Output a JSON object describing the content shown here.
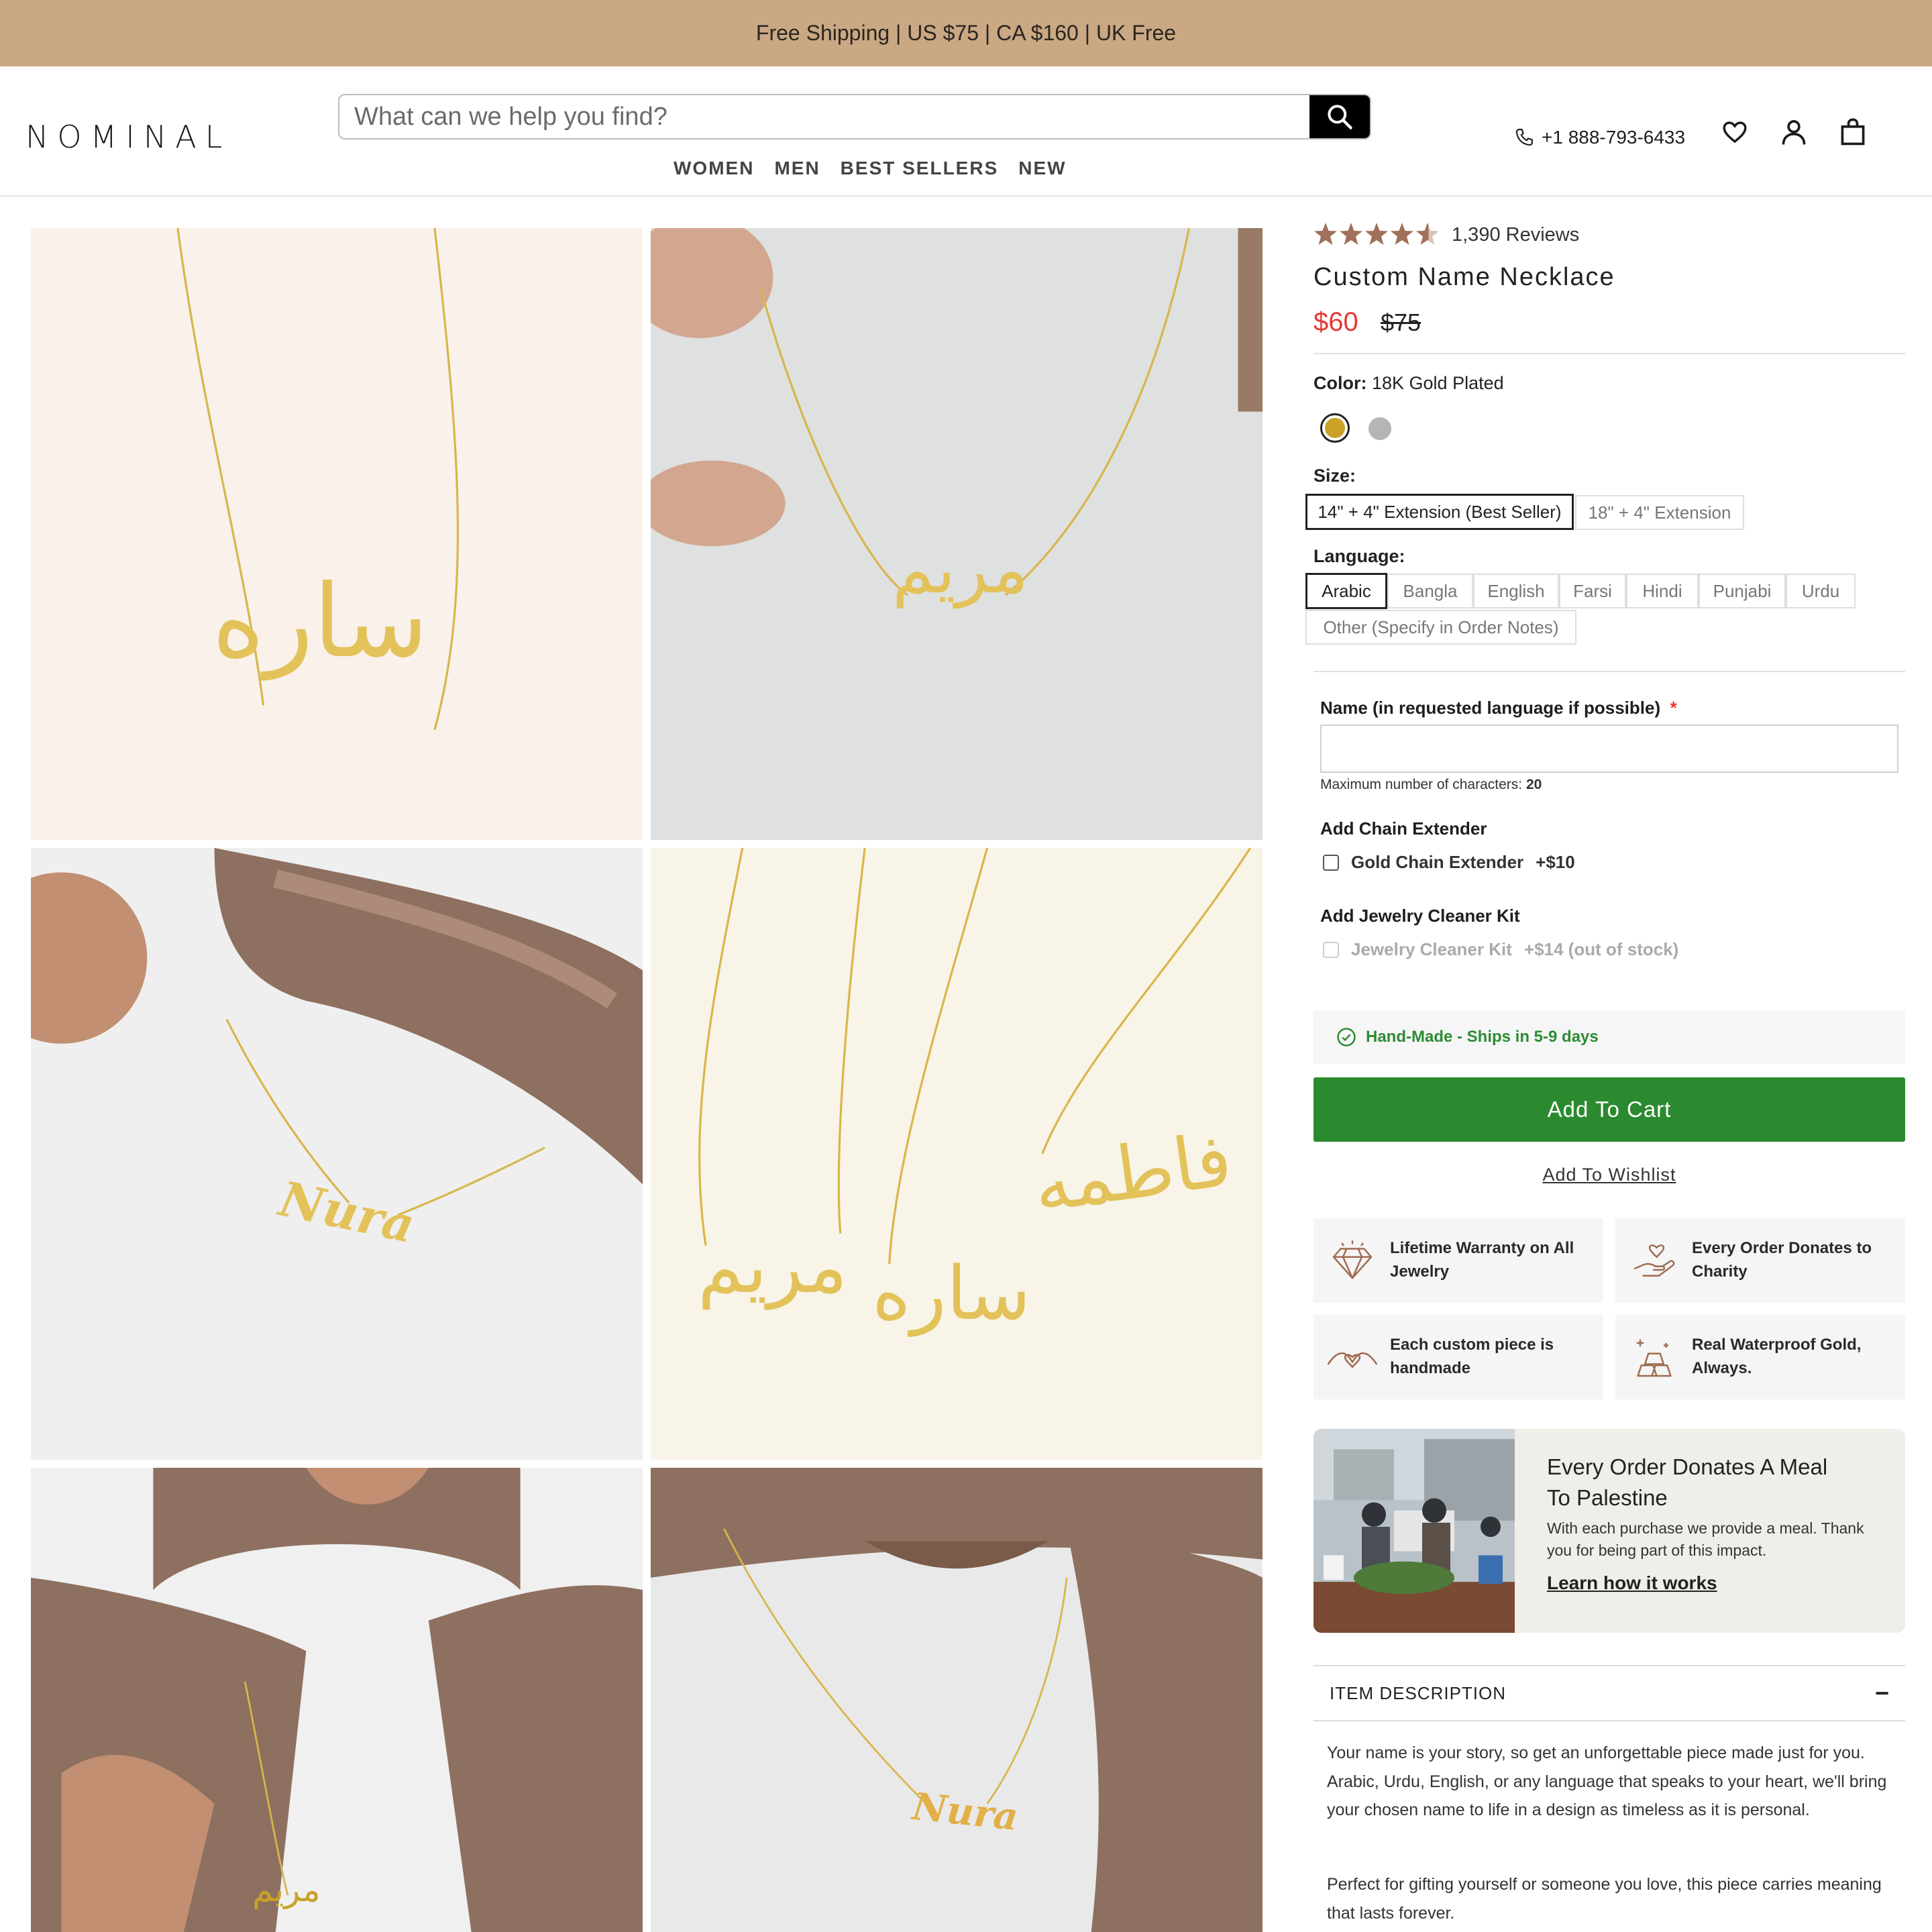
{
  "announcement": "Free Shipping | US $75 | CA $160 | UK Free",
  "header": {
    "logo": "NOMINAL",
    "search_placeholder": "What can we help you find?",
    "nav": [
      "WOMEN",
      "MEN",
      "BEST SELLERS",
      "NEW"
    ],
    "phone": "+1 888-793-6433"
  },
  "gallery": {
    "image_labels": [
      "ساره",
      "مريم",
      "Nura",
      "مريم",
      "ساره",
      "فاطمه",
      "مريم",
      "Nura"
    ]
  },
  "product": {
    "rating_value": 4.5,
    "reviews": "1,390 Reviews",
    "title": "Custom Name Necklace",
    "price": "$60",
    "compare_price": "$75",
    "color_label": "Color:",
    "color_value": "18K Gold Plated",
    "color_swatches": [
      "#c9a227",
      "#b5b5b5"
    ],
    "size_label": "Size:",
    "sizes": [
      "14\" + 4\" Extension (Best Seller)",
      "18\" + 4\" Extension"
    ],
    "language_label": "Language:",
    "languages": [
      "Arabic",
      "Bangla",
      "English",
      "Farsi",
      "Hindi",
      "Punjabi",
      "Urdu",
      "Other (Specify in Order Notes)"
    ],
    "name_label": "Name (in requested language if possible)",
    "required_mark": "*",
    "max_chars_label": "Maximum number of characters:",
    "max_chars": "20",
    "chain_title": "Add Chain Extender",
    "chain_option": "Gold Chain Extender",
    "chain_price": "+$10",
    "cleaner_title": "Add Jewelry Cleaner Kit",
    "cleaner_option": "Jewelry Cleaner Kit",
    "cleaner_price": "+$14 (out of stock)",
    "shipping_note": "Hand-Made - Ships in 5-9 days",
    "add_to_cart": "Add To Cart",
    "add_to_wishlist": "Add To Wishlist"
  },
  "features": [
    {
      "icon": "diamond-icon",
      "text": "Lifetime Warranty on All Jewelry"
    },
    {
      "icon": "giving-hand-icon",
      "text": "Every Order Donates to Charity"
    },
    {
      "icon": "heart-hands-icon",
      "text": "Each custom piece is handmade"
    },
    {
      "icon": "gold-bars-icon",
      "text": "Real Waterproof Gold, Always."
    }
  ],
  "donation": {
    "title": "Every Order Donates A Meal To Palestine",
    "text": "With each purchase we provide a meal. Thank you for being part of this impact.",
    "link": "Learn how it works"
  },
  "description": {
    "heading": "ITEM DESCRIPTION",
    "toggle": "−",
    "paragraphs": [
      "Your name is your story, so get an unforgettable piece made just for you. Arabic, Urdu, English, or any language that speaks to your heart, we'll bring your chosen name to life in a design as timeless as it is personal.",
      "Perfect for gifting yourself or someone you love, this piece carries meaning that lasts forever."
    ]
  },
  "colors": {
    "announce_bg": "#c9a883",
    "accent_green": "#2b8a2f",
    "sale_red": "#e53935",
    "star": "#a1705a"
  }
}
